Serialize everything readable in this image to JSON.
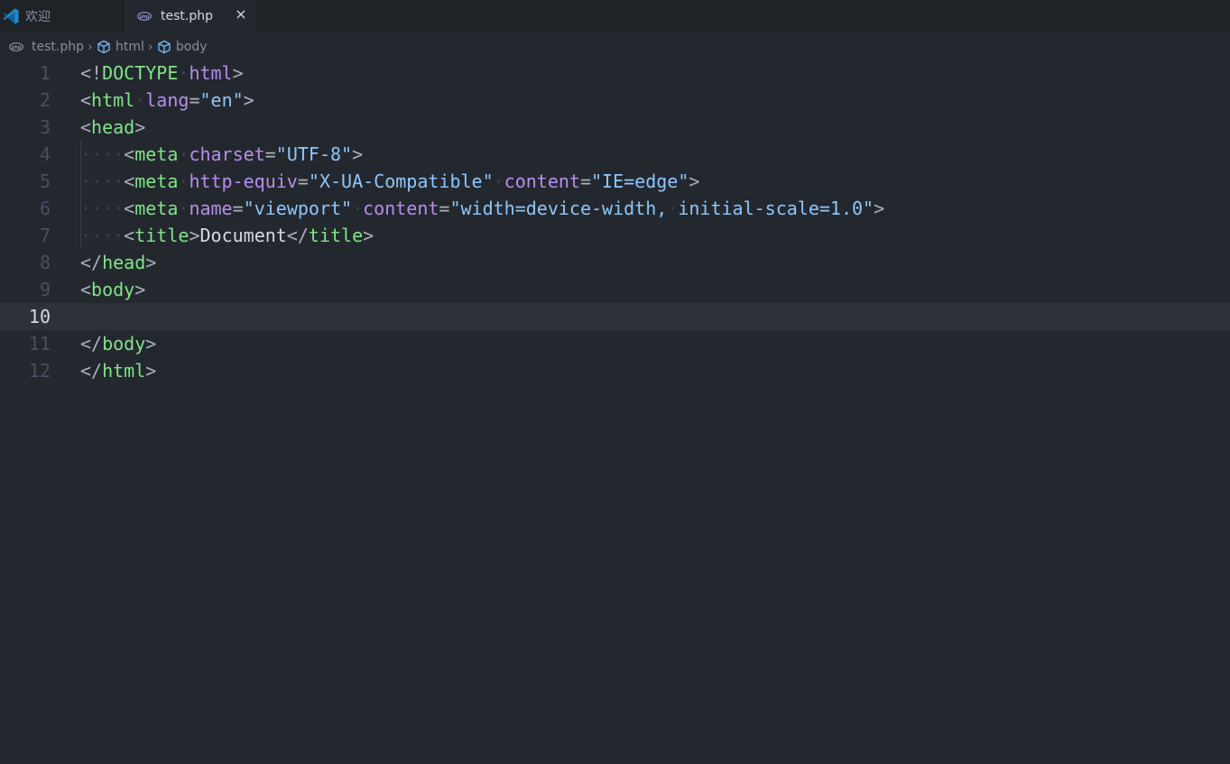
{
  "tabs": [
    {
      "label": "欢迎",
      "icon": "vscode-icon",
      "active": false
    },
    {
      "label": "test.php",
      "icon": "php-icon",
      "active": true,
      "close": "×"
    }
  ],
  "breadcrumb": [
    {
      "label": "test.php",
      "icon": "php-icon"
    },
    {
      "label": "html",
      "icon": "cube-icon"
    },
    {
      "label": "body",
      "icon": "cube-icon"
    }
  ],
  "breadcrumb_separator": "›",
  "editor": {
    "current_line": 10,
    "lines": [
      {
        "n": "1",
        "text": "<!DOCTYPE html>"
      },
      {
        "n": "2",
        "text": "<html lang=\"en\">"
      },
      {
        "n": "3",
        "text": "<head>"
      },
      {
        "n": "4",
        "text": "    <meta charset=\"UTF-8\">"
      },
      {
        "n": "5",
        "text": "    <meta http-equiv=\"X-UA-Compatible\" content=\"IE=edge\">"
      },
      {
        "n": "6",
        "text": "    <meta name=\"viewport\" content=\"width=device-width, initial-scale=1.0\">"
      },
      {
        "n": "7",
        "text": "    <title>Document</title>"
      },
      {
        "n": "8",
        "text": "</head>"
      },
      {
        "n": "9",
        "text": "<body>"
      },
      {
        "n": "10",
        "text": ""
      },
      {
        "n": "11",
        "text": "</body>"
      },
      {
        "n": "12",
        "text": "</html>"
      }
    ]
  },
  "colors": {
    "background": "#23272e",
    "tabbar": "#1e2227",
    "current_line": "#2c313a",
    "tag": "#7ee787",
    "attribute": "#b88ef0",
    "string": "#8cc8ff",
    "text": "#d7dae0"
  }
}
